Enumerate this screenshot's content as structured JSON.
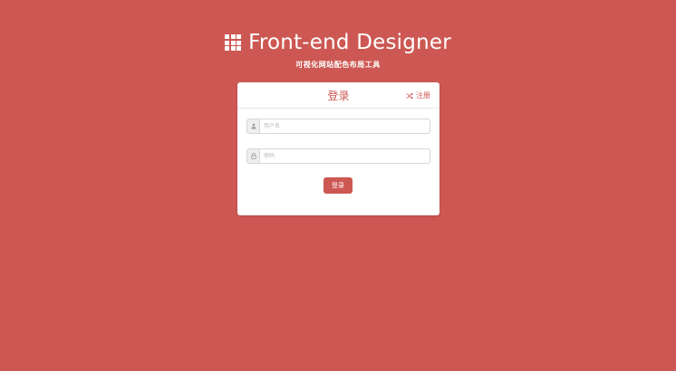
{
  "colors": {
    "background": "#cd5853",
    "accent": "#cd5853",
    "card": "#ffffff"
  },
  "brand": {
    "icon": "grid-icon",
    "title": "Front-end Designer",
    "subtitle": "可视化网站配色布局工具"
  },
  "login_card": {
    "title": "登录",
    "register_icon": "shuffle-icon",
    "register_label": "注册",
    "username": {
      "icon": "user-icon",
      "placeholder": "用户名",
      "value": ""
    },
    "password": {
      "icon": "lock-icon",
      "placeholder": "密码",
      "value": ""
    },
    "submit_label": "登录"
  }
}
